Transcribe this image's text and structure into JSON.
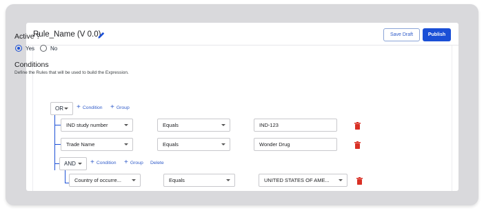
{
  "header": {
    "title": "Rule_Name (V 0.0)",
    "save_draft_label": "Save Draft",
    "publish_label": "Publish"
  },
  "active": {
    "heading": "Active ?",
    "yes_label": "Yes",
    "no_label": "No",
    "selected": "Yes"
  },
  "conditions": {
    "heading": "Conditions",
    "description": "Define the Rules that will be used to build the Expression.",
    "root_operator": "OR",
    "add_condition_label": "Condition",
    "add_group_label": "Group",
    "rows": [
      {
        "field": "IND study number",
        "operator": "Equals",
        "value": "IND-123"
      },
      {
        "field": "Trade Name",
        "operator": "Equals",
        "value": "Wonder Drug"
      }
    ],
    "group": {
      "operator": "AND",
      "add_condition_label": "Condition",
      "add_group_label": "Group",
      "delete_label": "Delete",
      "rows": [
        {
          "field": "Country of occurre...",
          "operator": "Equals",
          "value": "UNITED STATES OF AME..."
        }
      ]
    }
  },
  "colors": {
    "accent": "#1a4fd6",
    "delete": "#d93025"
  },
  "icons": [
    "pencil-icon",
    "trash-icon",
    "chevron-down-icon",
    "plus-icon"
  ]
}
